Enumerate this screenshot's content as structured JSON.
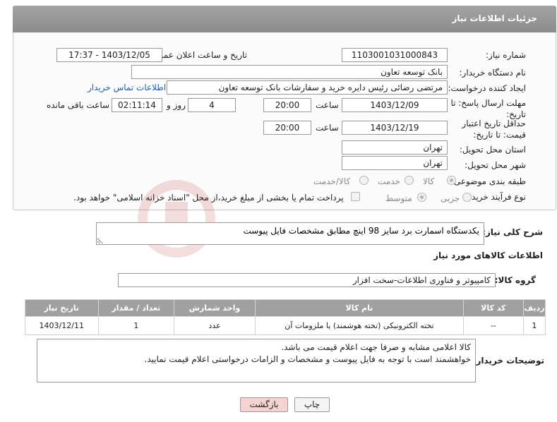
{
  "header": {
    "title": "جزئیات اطلاعات نیاز"
  },
  "fields": {
    "need_number_label": "شماره نیاز:",
    "need_number": "1103001031000843",
    "announce_label": "تاریخ و ساعت اعلان عمومی:",
    "announce_value": "1403/12/05 - 17:37",
    "buyer_org_label": "نام دستگاه خریدار:",
    "buyer_org": "بانک توسعه تعاون",
    "creator_label": "ایجاد کننده درخواست:",
    "creator": "مرتضی رضائی رئیس دایره خرید و سفارشات بانک توسعه تعاون",
    "contact_link": "اطلاعات تماس خریدار",
    "deadline_label": "مهلت ارسال پاسخ: تا تاریخ:",
    "deadline_date": "1403/12/09",
    "time_label": "ساعت",
    "deadline_time": "20:00",
    "days_value": "4",
    "days_label": "روز و",
    "remaining_time": "02:11:14",
    "remaining_label": "ساعت باقی مانده",
    "validity_label": "حداقل تاریخ اعتبار قیمت: تا تاریخ:",
    "validity_date": "1403/12/19",
    "validity_time": "20:00",
    "province_label": "استان محل تحویل:",
    "province": "تهران",
    "city_label": "شهر محل تحویل:",
    "city": "تهران",
    "category_label": "طبقه بندی موضوعی:",
    "category_options": [
      "کالا",
      "خدمت",
      "کالا/خدمت"
    ],
    "process_label": "نوع فرآیند خرید :",
    "process_options": [
      "جزیی",
      "متوسط"
    ],
    "payment_note": "پرداخت تمام یا بخشی از مبلغ خرید،از محل \"اسناد خزانه اسلامی\" خواهد بود."
  },
  "description": {
    "label": "شرح کلی نیاز:",
    "value": "یکدستگاه اسمارت برد سایز 98 اینچ مطابق مشخصات فایل پیوست"
  },
  "goods_info_title": "اطلاعات کالاهای مورد نیاز",
  "goods_group": {
    "label": "گروه کالا:",
    "value": "کامپیوتر و فناوری اطلاعات-سخت افزار"
  },
  "table": {
    "headers": [
      "ردیف",
      "کد کالا",
      "نام کالا",
      "واحد شمارش",
      "تعداد / مقدار",
      "تاریخ نیاز"
    ],
    "rows": [
      [
        "1",
        "--",
        "تخته الکترونیکی (تخته هوشمند) یا ملزومات آن",
        "عدد",
        "1",
        "1403/12/11"
      ]
    ]
  },
  "buyer_notes": {
    "label": "توضیحات خریدار:",
    "line1": "کالا اعلامی مشابه و صرفا جهت اعلام قیمت می باشد.",
    "line2": "خواهشمند است با توجه به فایل پیوست و مشخصات و الزامات درخواستی اعلام قیمت نمایید."
  },
  "buttons": {
    "print": "چاپ",
    "back": "بازگشت"
  },
  "watermark_text": "AriaTender.net",
  "colors": {
    "header": "#9a9a9a",
    "link": "#1a5fb4",
    "back_button": "#f6d3d3"
  }
}
